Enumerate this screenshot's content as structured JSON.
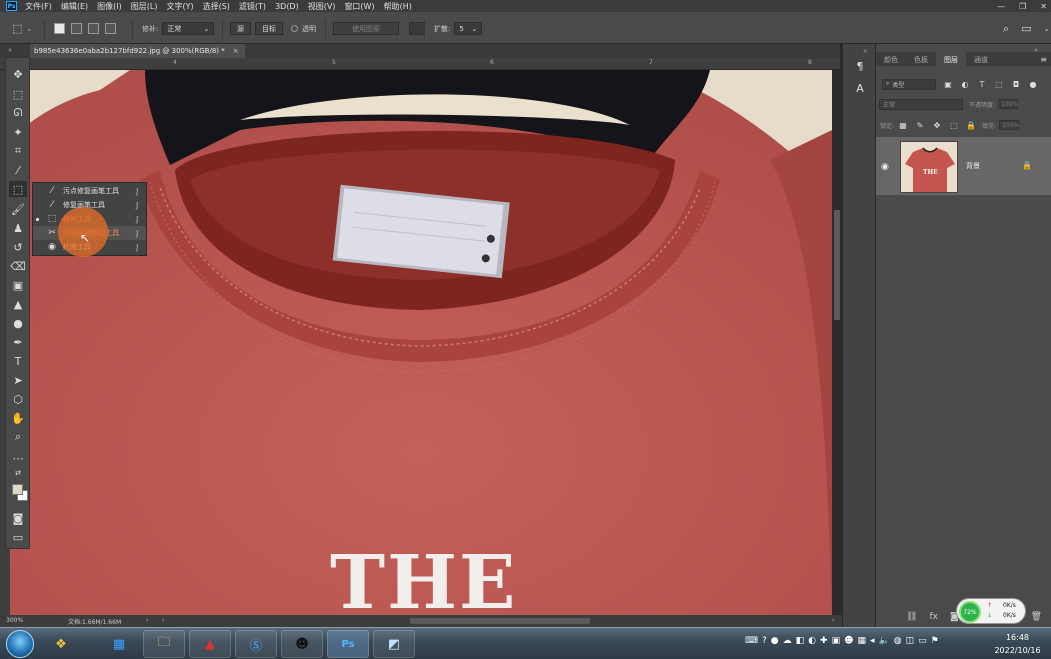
{
  "app": {
    "logo": "Ps"
  },
  "menu": [
    "文件(F)",
    "编辑(E)",
    "图像(I)",
    "图层(L)",
    "文字(Y)",
    "选择(S)",
    "滤镜(T)",
    "3D(D)",
    "视图(V)",
    "窗口(W)",
    "帮助(H)"
  ],
  "window_controls": [
    "—",
    "❐",
    "✕"
  ],
  "options": {
    "patch_label": "修补:",
    "patch_value": "正常",
    "source_label": "源",
    "dest_label": "目标",
    "transparent_label": "透明",
    "use_pattern_label": "使用图案",
    "diffusion_label": "扩散:",
    "diffusion_value": "5"
  },
  "document": {
    "tab_title": "b985e43636e0aba2b127bfd922.jpg @ 300%(RGB/8) *",
    "tab_close": "×",
    "zoom": "300%",
    "doc_info": "文档:1.66M/1.66M",
    "ruler_ticks": [
      "4",
      "5",
      "6",
      "7",
      "8"
    ],
    "shirt_text": "THE"
  },
  "flyout": {
    "items": [
      {
        "icon": "spot-healing-icon",
        "label": "污点修复画笔工具",
        "key": "J"
      },
      {
        "icon": "healing-brush-icon",
        "label": "修复画笔工具",
        "key": "J"
      },
      {
        "icon": "patch-icon",
        "label": "修补工具",
        "key": "J"
      },
      {
        "icon": "content-aware-move-icon",
        "label": "内容感知移动工具",
        "key": "J"
      },
      {
        "icon": "red-eye-icon",
        "label": "红眼工具",
        "key": "J"
      }
    ]
  },
  "layers_panel": {
    "tabs": [
      "颜色",
      "色板",
      "图层",
      "通道"
    ],
    "active_tab": "图层",
    "filter_label": "类型",
    "blend_mode": "正常",
    "opacity_label": "不透明度:",
    "opacity_value": "100%",
    "lock_label": "锁定:",
    "fill_label": "填充:",
    "fill_value": "100%",
    "layer_name": "背景",
    "thumb_text": "THE"
  },
  "net_widget": {
    "percent": "72%",
    "up": "0K/s",
    "down": "0K/s"
  },
  "taskbar": {
    "time": "16:48",
    "date": "2022/10/16"
  },
  "colors": {
    "shirt": "#bf5b54",
    "accent_orange": "#ff8a44",
    "panel": "#4a4a4a"
  }
}
